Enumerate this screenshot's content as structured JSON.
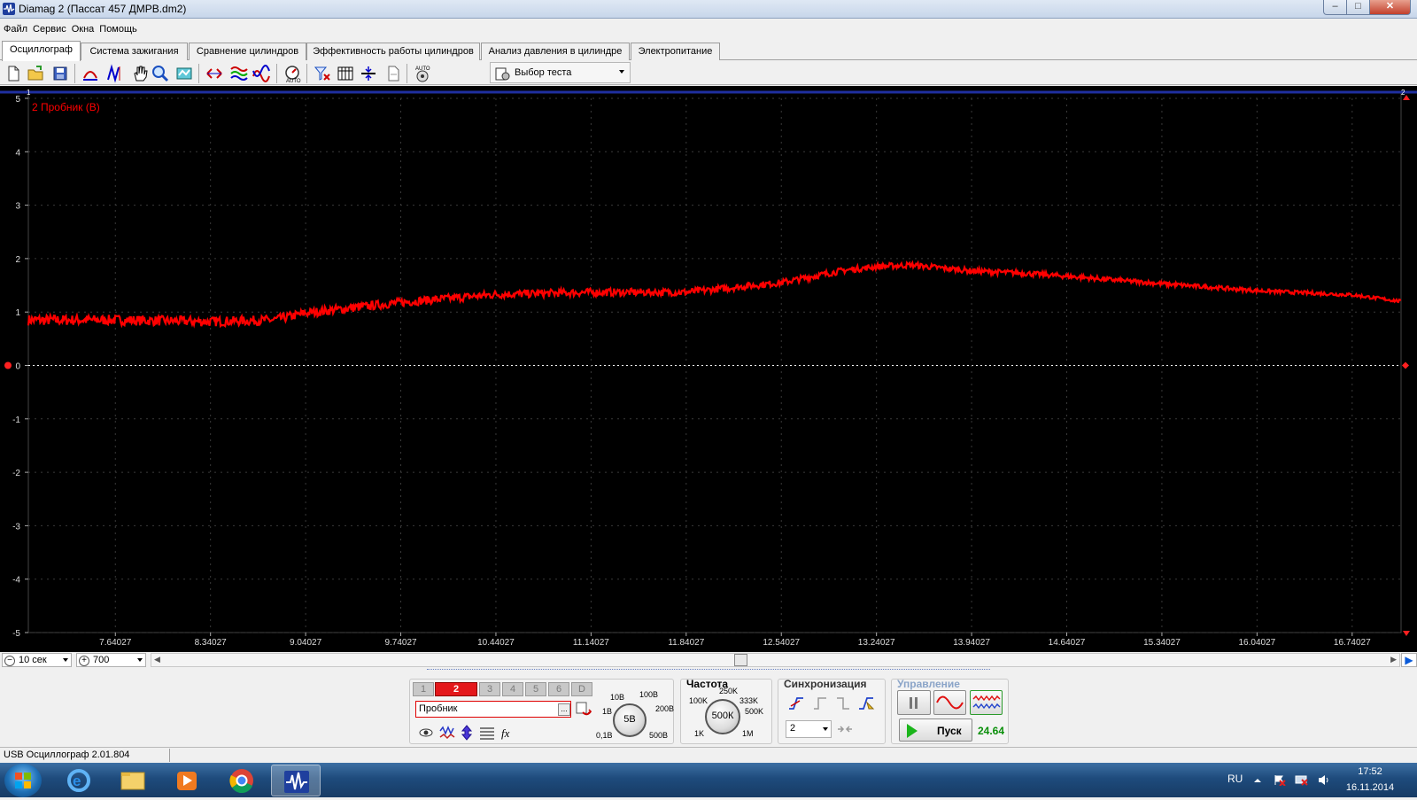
{
  "window": {
    "title": "Diamag 2 (Пассат 457 ДМРВ.dm2)",
    "min": "–",
    "max": "□",
    "close": "✕"
  },
  "menu": [
    "Файл",
    "Сервис",
    "Окна",
    "Помощь"
  ],
  "tabs": [
    "Осциллограф",
    "Система зажигания",
    "Сравнение цилиндров",
    "Эффективность работы цилиндров",
    "Анализ давления в цилиндре",
    "Электропитание"
  ],
  "active_tab": 0,
  "toolbar": {
    "test_select": "Выбор теста"
  },
  "scope": {
    "channel_label": "2 Пробник (В)",
    "trace_color": "#ff0000",
    "marker_left": "1",
    "marker_right": "2",
    "y_ticks": [
      "5",
      "4",
      "3",
      "2",
      "1",
      "0",
      "-1",
      "-2",
      "-3",
      "-4",
      "-5"
    ],
    "x_ticks": [
      "7.64027",
      "8.34027",
      "9.04027",
      "9.74027",
      "10.44027",
      "11.14027",
      "11.84027",
      "12.54027",
      "13.24027",
      "13.94027",
      "14.64027",
      "15.34027",
      "16.04027",
      "16.74027"
    ]
  },
  "chart_data": {
    "type": "line",
    "title": "",
    "xlabel": "",
    "ylabel": "",
    "xlim": [
      7.0,
      17.1
    ],
    "ylim": [
      -5,
      5
    ],
    "grid": true,
    "series": [
      {
        "name": "2 Пробник (В)",
        "color": "#ff0000",
        "x": [
          7.0,
          7.64,
          8.34,
          8.8,
          9.04,
          9.74,
          10.44,
          11.14,
          11.84,
          12.54,
          13.0,
          13.24,
          13.5,
          13.94,
          14.3,
          14.64,
          15.34,
          16.04,
          16.74,
          17.1
        ],
        "y": [
          0.85,
          0.85,
          0.82,
          0.85,
          0.98,
          1.18,
          1.33,
          1.37,
          1.37,
          1.55,
          1.78,
          1.85,
          1.88,
          1.77,
          1.73,
          1.67,
          1.53,
          1.4,
          1.32,
          1.2
        ]
      }
    ]
  },
  "hscroll": {
    "time_base": "10 сек",
    "zoom": "700"
  },
  "channels": {
    "buttons": [
      "1",
      "2",
      "3",
      "4",
      "5",
      "6",
      "D"
    ],
    "active": "2",
    "probe": "Пробник",
    "more": "..."
  },
  "voltage_knob": {
    "value": "5В",
    "labels": [
      "10В",
      "100В",
      "1В",
      "200В",
      "0,1В",
      "500В"
    ]
  },
  "freq": {
    "title": "Частота",
    "value": "500К",
    "labels": [
      "250K",
      "100K",
      "333K",
      "500K",
      "1K",
      "1M"
    ]
  },
  "sync": {
    "title": "Синхронизация",
    "channel": "2"
  },
  "control": {
    "title": "Управление",
    "run": "Пуск",
    "fps": "24.64"
  },
  "status": {
    "device": "USB Осциллограф  2.01.804"
  },
  "taskbar": {
    "lang": "RU",
    "time": "17:52",
    "date": "16.11.2014"
  }
}
